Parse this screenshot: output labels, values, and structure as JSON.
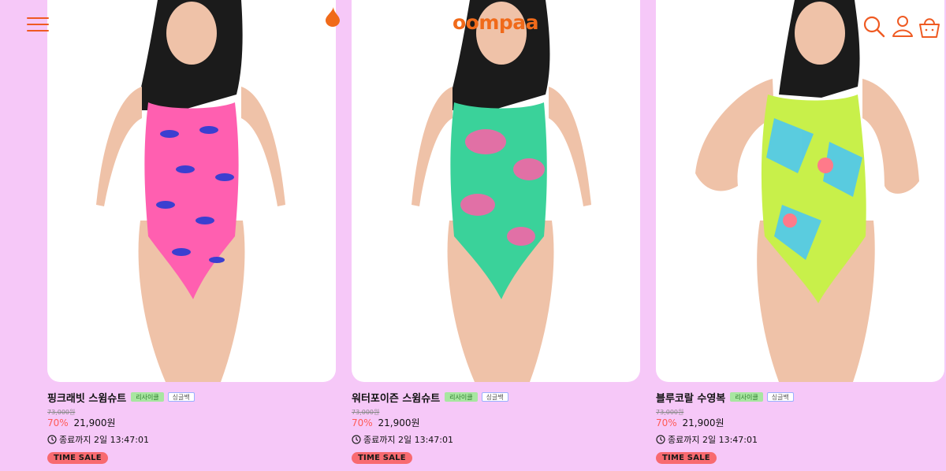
{
  "header": {
    "logo": "oompaa",
    "accent": "#ef5a22",
    "icons": [
      "menu-icon",
      "droplet-icon",
      "search-icon",
      "user-icon",
      "basket-icon"
    ]
  },
  "colors": {
    "background": "#f6c8f8",
    "discount": "#ff5b57",
    "badge": "#f86a70",
    "tag_green": "#a8e6a1"
  },
  "products": [
    {
      "name": "핑크래빗 스윔슈트",
      "tags": [
        "리사이클",
        "싱글백"
      ],
      "original_price": "73,000원",
      "discount": "70%",
      "price": "21,900원",
      "timer": "종료까지 2일 13:47:01",
      "badge": "TIME SALE",
      "swimsuit_colors": [
        "#ff5fb0",
        "#3b3fd0"
      ]
    },
    {
      "name": "워터포이즌 스윔슈트",
      "tags": [
        "리사이클",
        "싱글백"
      ],
      "original_price": "73,000원",
      "discount": "70%",
      "price": "21,900원",
      "timer": "종료까지 2일 13:47:01",
      "badge": "TIME SALE",
      "swimsuit_colors": [
        "#3ad29a",
        "#ff5fa8"
      ]
    },
    {
      "name": "블루코랄 수영복",
      "tags": [
        "리사이클",
        "싱글백"
      ],
      "original_price": "73,000원",
      "discount": "70%",
      "price": "21,900원",
      "timer": "종료까지 2일 13:47:01",
      "badge": "TIME SALE",
      "swimsuit_colors": [
        "#c8f04a",
        "#4ec8f0"
      ]
    }
  ]
}
